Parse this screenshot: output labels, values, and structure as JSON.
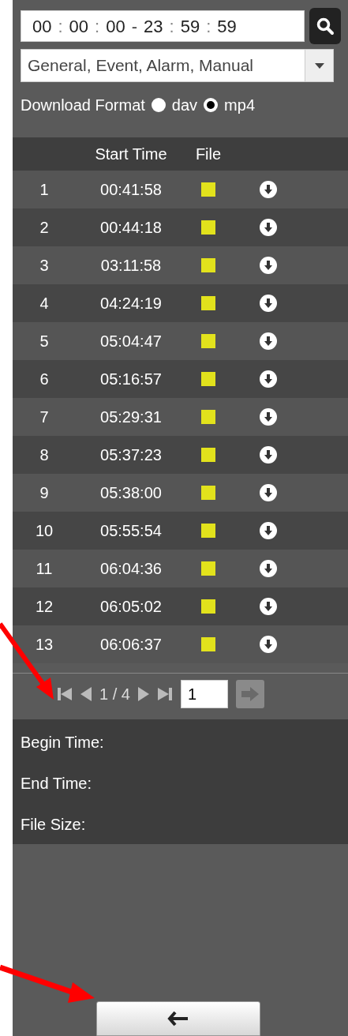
{
  "time_range": {
    "start": [
      "00",
      "00",
      "00"
    ],
    "end": [
      "23",
      "59",
      "59"
    ],
    "separator": ":",
    "dash": "-"
  },
  "record_type": {
    "value": "General, Event, Alarm, Manual"
  },
  "download_format": {
    "label": "Download Format",
    "options": [
      {
        "label": "dav",
        "selected": false
      },
      {
        "label": "mp4",
        "selected": true
      }
    ]
  },
  "table": {
    "columns": [
      "Start Time",
      "File"
    ],
    "rows": [
      {
        "index": "1",
        "start_time": "00:41:58"
      },
      {
        "index": "2",
        "start_time": "00:44:18"
      },
      {
        "index": "3",
        "start_time": "03:11:58"
      },
      {
        "index": "4",
        "start_time": "04:24:19"
      },
      {
        "index": "5",
        "start_time": "05:04:47"
      },
      {
        "index": "6",
        "start_time": "05:16:57"
      },
      {
        "index": "7",
        "start_time": "05:29:31"
      },
      {
        "index": "8",
        "start_time": "05:37:23"
      },
      {
        "index": "9",
        "start_time": "05:38:00"
      },
      {
        "index": "10",
        "start_time": "05:55:54"
      },
      {
        "index": "11",
        "start_time": "06:04:36"
      },
      {
        "index": "12",
        "start_time": "06:05:02"
      },
      {
        "index": "13",
        "start_time": "06:06:37"
      }
    ]
  },
  "pagination": {
    "page": "1 / 4",
    "page_input": "1"
  },
  "file_info": [
    "Begin Time:",
    "End Time:",
    "File Size:"
  ]
}
